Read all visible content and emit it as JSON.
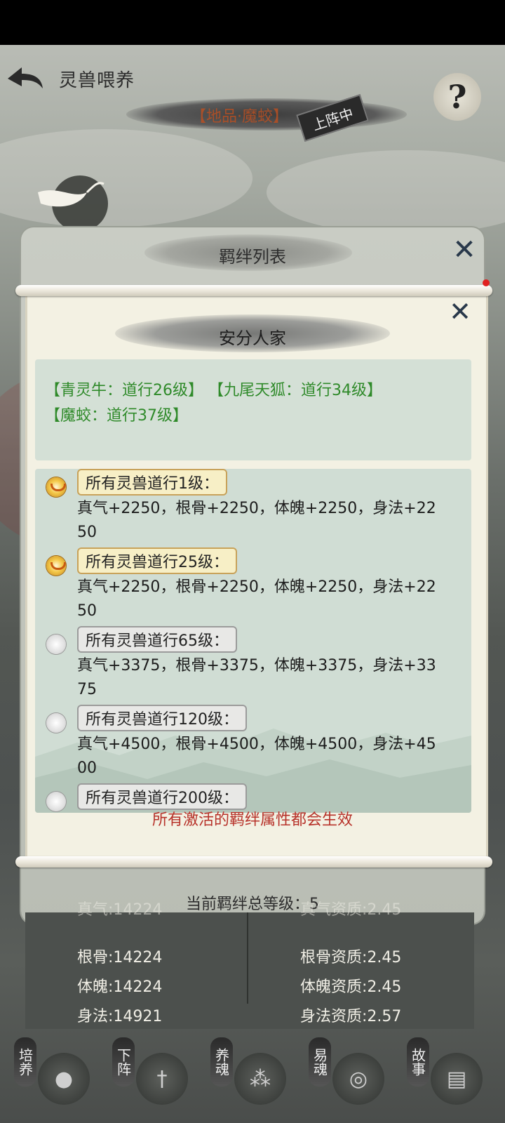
{
  "header": {
    "title": "灵兽喂养",
    "help_label": "?",
    "pet_name": "【地品·魔蛟】",
    "deploy_tag": "上阵中"
  },
  "outer_dialog": {
    "title": "羁绊列表",
    "close_label": "✕",
    "footer_label": "当前羁绊总等级：5"
  },
  "bond_dialog": {
    "title": "安分人家",
    "close_label": "✕",
    "members": [
      "【青灵牛：道行26级】 【九尾天狐：道行34级】",
      "【魔蛟：道行37级】"
    ],
    "tiers": [
      {
        "label": "所有灵兽道行1级：",
        "bonus": "真气+2250，根骨+2250，体魄+2250，身法+2250",
        "active": true
      },
      {
        "label": "所有灵兽道行25级：",
        "bonus": "真气+2250，根骨+2250，体魄+2250，身法+2250",
        "active": true
      },
      {
        "label": "所有灵兽道行65级：",
        "bonus": "真气+3375，根骨+3375，体魄+3375，身法+3375",
        "active": false
      },
      {
        "label": "所有灵兽道行120级：",
        "bonus": "真气+4500，根骨+4500，体魄+4500，身法+4500",
        "active": false
      },
      {
        "label": "所有灵兽道行200级：",
        "bonus": "",
        "active": false
      }
    ],
    "hint": "所有激活的羁绊属性都会生效"
  },
  "stats": {
    "left": [
      "真气:14224",
      "根骨:14224",
      "体魄:14224",
      "身法:14921"
    ],
    "right": [
      "真气资质:2.45",
      "根骨资质:2.45",
      "体魄资质:2.45",
      "身法资质:2.57"
    ]
  },
  "nav": {
    "items": [
      {
        "label": "培养",
        "icon": "orb-icon"
      },
      {
        "label": "下阵",
        "icon": "sword-icon"
      },
      {
        "label": "养魂",
        "icon": "constellation-icon"
      },
      {
        "label": "易魂",
        "icon": "seal-icon"
      },
      {
        "label": "故事",
        "icon": "scroll-icon"
      }
    ]
  },
  "colors": {
    "member_text": "#2f8a2a",
    "hint_text": "#b7322a",
    "active_tier_bg": "#f7efc6"
  }
}
